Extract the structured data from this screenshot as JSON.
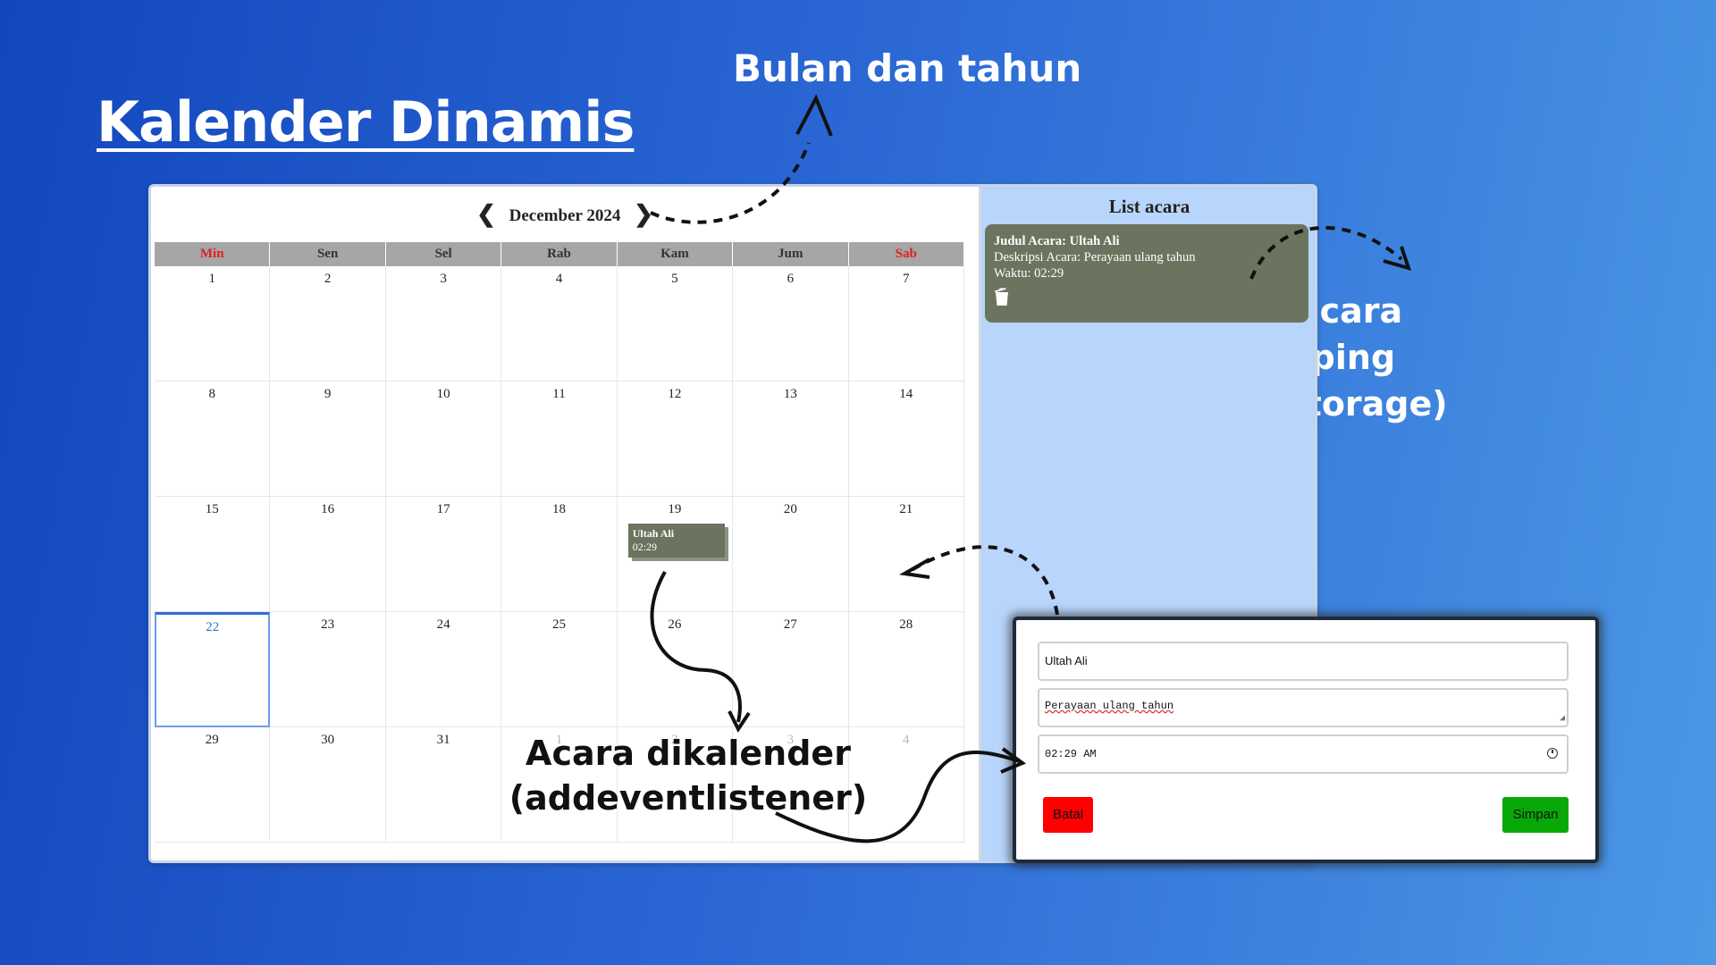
{
  "page": {
    "title": "Kalender Dinamis",
    "annotations": {
      "month_year": "Bulan dan tahun",
      "side_list_line1": "list acara samping",
      "side_list_line2": "(localstorage)",
      "calendar_event_line1": "Acara dikalender",
      "calendar_event_line2": "(addeventlistener)"
    }
  },
  "calendar": {
    "prev_icon": "chevron-left-icon",
    "next_icon": "chevron-right-icon",
    "month_label": "December 2024",
    "weekdays": [
      "Min",
      "Sen",
      "Sel",
      "Rab",
      "Kam",
      "Jum",
      "Sab"
    ],
    "days": [
      "1",
      "2",
      "3",
      "4",
      "5",
      "6",
      "7",
      "8",
      "9",
      "10",
      "11",
      "12",
      "13",
      "14",
      "15",
      "16",
      "17",
      "18",
      "19",
      "20",
      "21",
      "22",
      "23",
      "24",
      "25",
      "26",
      "27",
      "28",
      "29",
      "30",
      "31",
      "1",
      "2",
      "3",
      "4"
    ],
    "today_index": 21,
    "event": {
      "day_index": 18,
      "title": "Ultah Ali",
      "time": "02:29"
    }
  },
  "sidebar": {
    "title": "List acara",
    "events": [
      {
        "title": "Judul Acara: Ultah Ali",
        "description": "Deskripsi Acara: Perayaan ulang tahun",
        "time": "Waktu: 02:29",
        "delete_icon": "trash-icon"
      }
    ]
  },
  "modal": {
    "title_value": "Ultah Ali",
    "description_value": "Perayaan ulang tahun",
    "time_value": "02:29 AM",
    "cancel_label": "Batal",
    "save_label": "Simpan"
  },
  "colors": {
    "event_bg": "#6c745f",
    "sidebar_bg": "#b8d5fb",
    "cancel_btn": "#ff0000",
    "save_btn": "#08a808",
    "weekend_header": "#e02020"
  }
}
